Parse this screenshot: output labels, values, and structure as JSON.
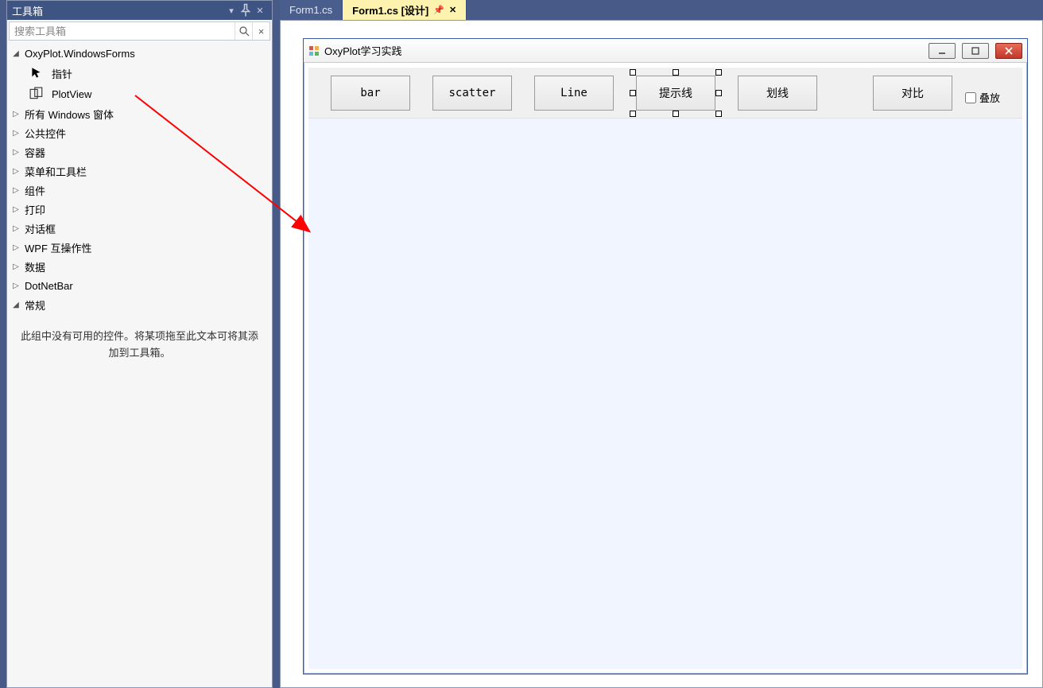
{
  "toolbox": {
    "title": "工具箱",
    "search_placeholder": "搜索工具箱",
    "groups": {
      "oxyplot": {
        "label": "OxyPlot.WindowsForms",
        "expanded": true
      },
      "oxyplot_items": {
        "pointer": "指针",
        "plotview": "PlotView"
      },
      "allwin": {
        "label": "所有 Windows 窗体"
      },
      "common": {
        "label": "公共控件"
      },
      "container": {
        "label": "容器"
      },
      "menus": {
        "label": "菜单和工具栏"
      },
      "components": {
        "label": "组件"
      },
      "print": {
        "label": "打印"
      },
      "dialog": {
        "label": "对话框"
      },
      "wpf": {
        "label": "WPF 互操作性"
      },
      "data": {
        "label": "数据"
      },
      "dotnetbar": {
        "label": "DotNetBar"
      },
      "general": {
        "label": "常规",
        "expanded": true
      }
    },
    "empty_msg": "此组中没有可用的控件。将某项拖至此文本可将其添加到工具箱。"
  },
  "tabs": {
    "code": {
      "label": "Form1.cs"
    },
    "design": {
      "label": "Form1.cs [设计]"
    }
  },
  "form": {
    "title": "OxyPlot学习实践",
    "buttons": {
      "bar": "bar",
      "scatter": "scatter",
      "line": "Line",
      "hint": "提示线",
      "mark": "划线",
      "compare": "对比"
    },
    "checkbox_label": "叠放"
  }
}
